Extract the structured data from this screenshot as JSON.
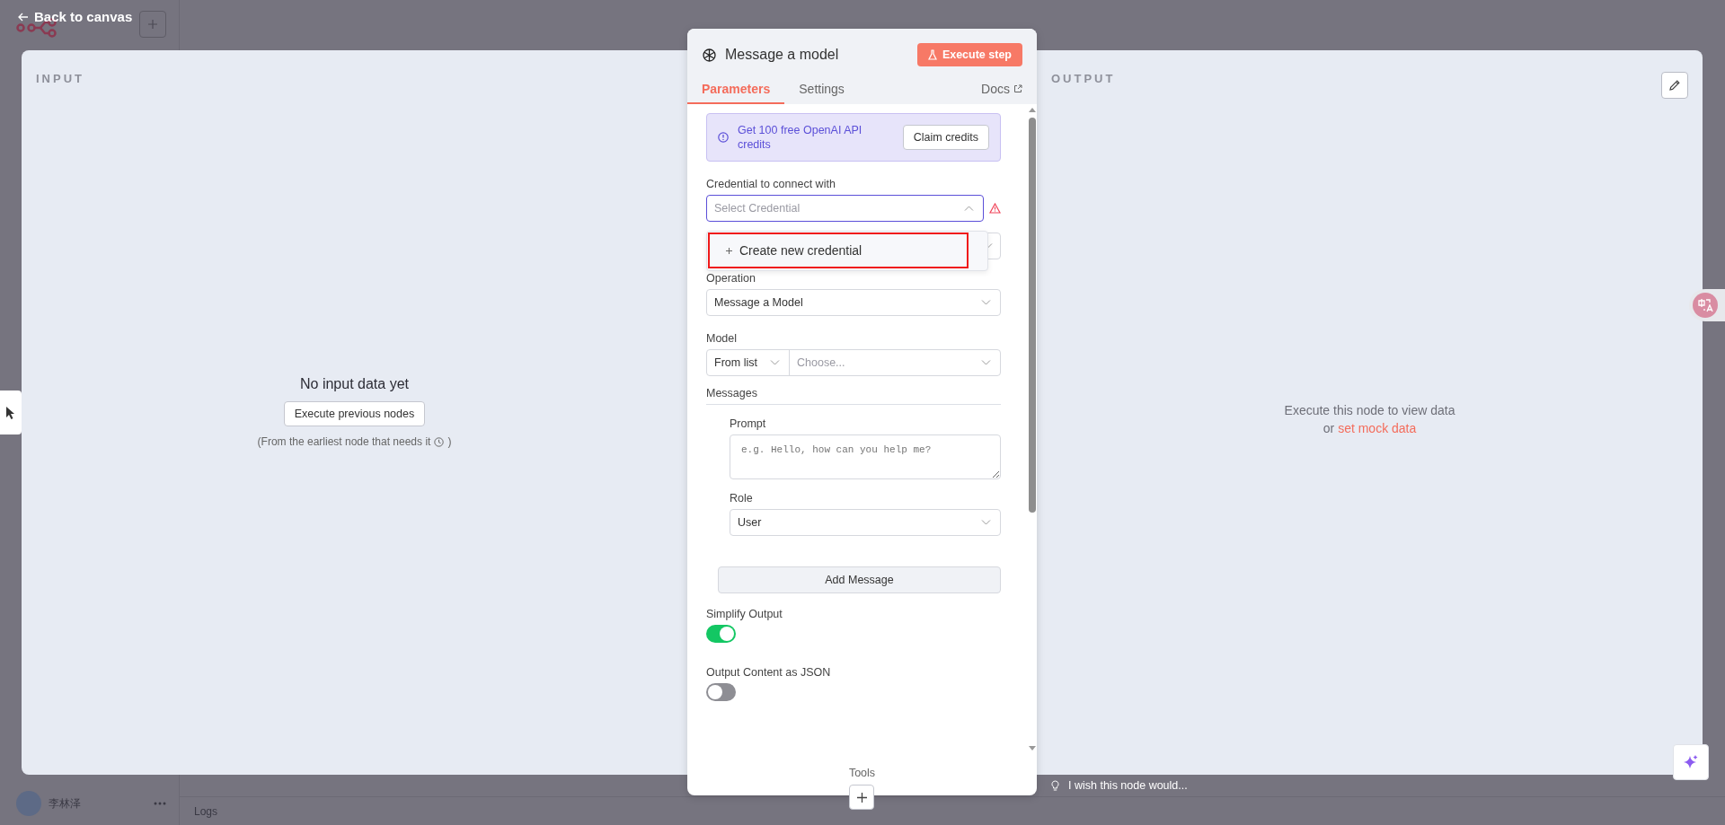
{
  "background": {
    "back_link": "Back to canvas",
    "user_name": "李林泽",
    "logs_label": "Logs"
  },
  "input": {
    "title": "INPUT",
    "empty_message": "No input data yet",
    "button": "Execute previous nodes",
    "hint": "(From the earliest node that needs it",
    "hint_end": ")"
  },
  "node": {
    "title": "Message a model",
    "execute_button": "Execute step",
    "tabs": [
      {
        "label": "Parameters",
        "selected": true
      },
      {
        "label": "Settings",
        "selected": false
      }
    ],
    "docs_link": "Docs",
    "callout": {
      "text": "Get 100 free OpenAI API credits",
      "button": "Claim credits"
    },
    "credential": {
      "label": "Credential to connect with",
      "placeholder": "Select Credential",
      "expanded": true,
      "warning": true,
      "menu_item": "Create new credential",
      "highlighted": true
    },
    "operation": {
      "label": "Operation",
      "value": "Message a Model"
    },
    "model": {
      "label": "Model",
      "mode": "From list",
      "placeholder": "Choose..."
    },
    "messages": {
      "label": "Messages",
      "prompt_label": "Prompt",
      "prompt_placeholder": "e.g. Hello, how can you help me?",
      "role_label": "Role",
      "role_value": "User",
      "add_button": "Add Message"
    },
    "toggles": [
      {
        "label": "Simplify Output",
        "on": true
      },
      {
        "label": "Output Content as JSON",
        "on": false
      }
    ],
    "tools_label": "Tools"
  },
  "output": {
    "title": "OUTPUT",
    "message": "Execute this node to view data",
    "or": "or",
    "mock_link": "set mock data"
  },
  "feedback": "I wish this node would..."
}
